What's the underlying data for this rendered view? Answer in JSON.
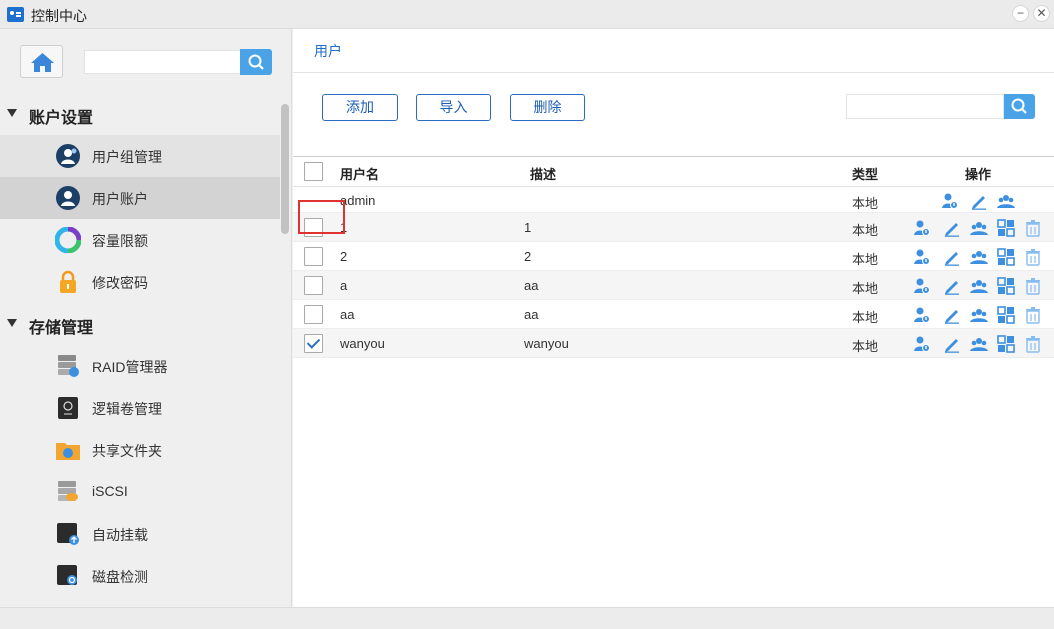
{
  "window": {
    "title": "控制中心",
    "minimize_glyph": "−",
    "close_glyph": "✕"
  },
  "sidebar": {
    "search": {
      "value": "",
      "placeholder": ""
    },
    "sections": [
      {
        "label": "账户设置",
        "items": [
          {
            "label": "用户组管理",
            "icon": "user-group-icon",
            "state": "hover"
          },
          {
            "label": "用户账户",
            "icon": "user-account-icon",
            "state": "active"
          },
          {
            "label": "容量限额",
            "icon": "quota-icon",
            "state": ""
          },
          {
            "label": "修改密码",
            "icon": "lock-icon",
            "state": ""
          }
        ]
      },
      {
        "label": "存储管理",
        "items": [
          {
            "label": "RAID管理器",
            "icon": "raid-icon",
            "state": ""
          },
          {
            "label": "逻辑卷管理",
            "icon": "logical-volume-icon",
            "state": ""
          },
          {
            "label": "共享文件夹",
            "icon": "shared-folder-icon",
            "state": ""
          },
          {
            "label": "iSCSI",
            "icon": "iscsi-icon",
            "state": ""
          },
          {
            "label": "自动挂载",
            "icon": "automount-icon",
            "state": ""
          },
          {
            "label": "磁盘检测",
            "icon": "disk-check-icon",
            "state": ""
          }
        ]
      }
    ]
  },
  "main": {
    "breadcrumb": "用户",
    "toolbar": {
      "add": "添加",
      "import": "导入",
      "delete": "删除"
    },
    "search": {
      "value": "",
      "placeholder": ""
    },
    "table": {
      "columns": {
        "username": "用户名",
        "description": "描述",
        "type": "类型",
        "actions": "操作"
      },
      "rows": [
        {
          "username": "admin",
          "description": "",
          "type": "本地",
          "checkbox": false,
          "checked": false,
          "actions": [
            "key-user-icon",
            "edit-icon",
            "group-icon"
          ]
        },
        {
          "username": "1",
          "description": "1",
          "type": "本地",
          "checkbox": true,
          "checked": false,
          "actions": [
            "key-user-icon",
            "edit-icon",
            "group-icon",
            "apps-icon",
            "trash-icon"
          ]
        },
        {
          "username": "2",
          "description": "2",
          "type": "本地",
          "checkbox": true,
          "checked": false,
          "actions": [
            "key-user-icon",
            "edit-icon",
            "group-icon",
            "apps-icon",
            "trash-icon"
          ]
        },
        {
          "username": "a",
          "description": "aa",
          "type": "本地",
          "checkbox": true,
          "checked": false,
          "actions": [
            "key-user-icon",
            "edit-icon",
            "group-icon",
            "apps-icon",
            "trash-icon"
          ]
        },
        {
          "username": "aa",
          "description": "aa",
          "type": "本地",
          "checkbox": true,
          "checked": false,
          "actions": [
            "key-user-icon",
            "edit-icon",
            "group-icon",
            "apps-icon",
            "trash-icon"
          ]
        },
        {
          "username": "wanyou",
          "description": "wanyou",
          "type": "本地",
          "checkbox": true,
          "checked": true,
          "actions": [
            "key-user-icon",
            "edit-icon",
            "group-icon",
            "apps-icon",
            "trash-icon"
          ]
        }
      ]
    }
  },
  "colors": {
    "accent": "#1d6fd0",
    "action_icon": "#3d8fe0",
    "search_button": "#4aa3e6",
    "highlight": "#e0322f"
  }
}
